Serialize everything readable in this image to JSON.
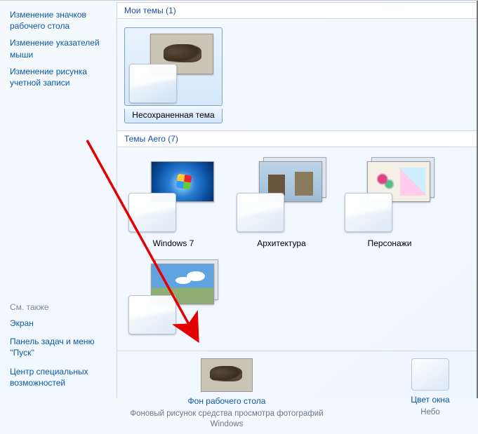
{
  "sidebar": {
    "top_links": [
      "Изменение значков рабочего стола",
      "Изменение указателей мыши",
      "Изменение рисунка учетной записи"
    ],
    "see_also_label": "См. также",
    "bottom_links": [
      "Экран",
      "Панель задач и меню ''Пуск''",
      "Центр специальных возможностей"
    ]
  },
  "sections": {
    "my_themes": {
      "title": "Мои темы (1)"
    },
    "aero_themes": {
      "title": "Темы Aero (7)"
    }
  },
  "my_themes": [
    {
      "label": "Несохраненная тема"
    }
  ],
  "aero_themes": [
    {
      "label": "Windows 7"
    },
    {
      "label": "Архитектура"
    },
    {
      "label": "Персонажи"
    },
    {
      "label": ""
    }
  ],
  "bottom": {
    "wallpaper_link": "Фон рабочего стола",
    "wallpaper_desc": "Фоновый рисунок средства просмотра фотографий Windows",
    "color_link": "Цвет окна",
    "color_desc": "Небо"
  }
}
